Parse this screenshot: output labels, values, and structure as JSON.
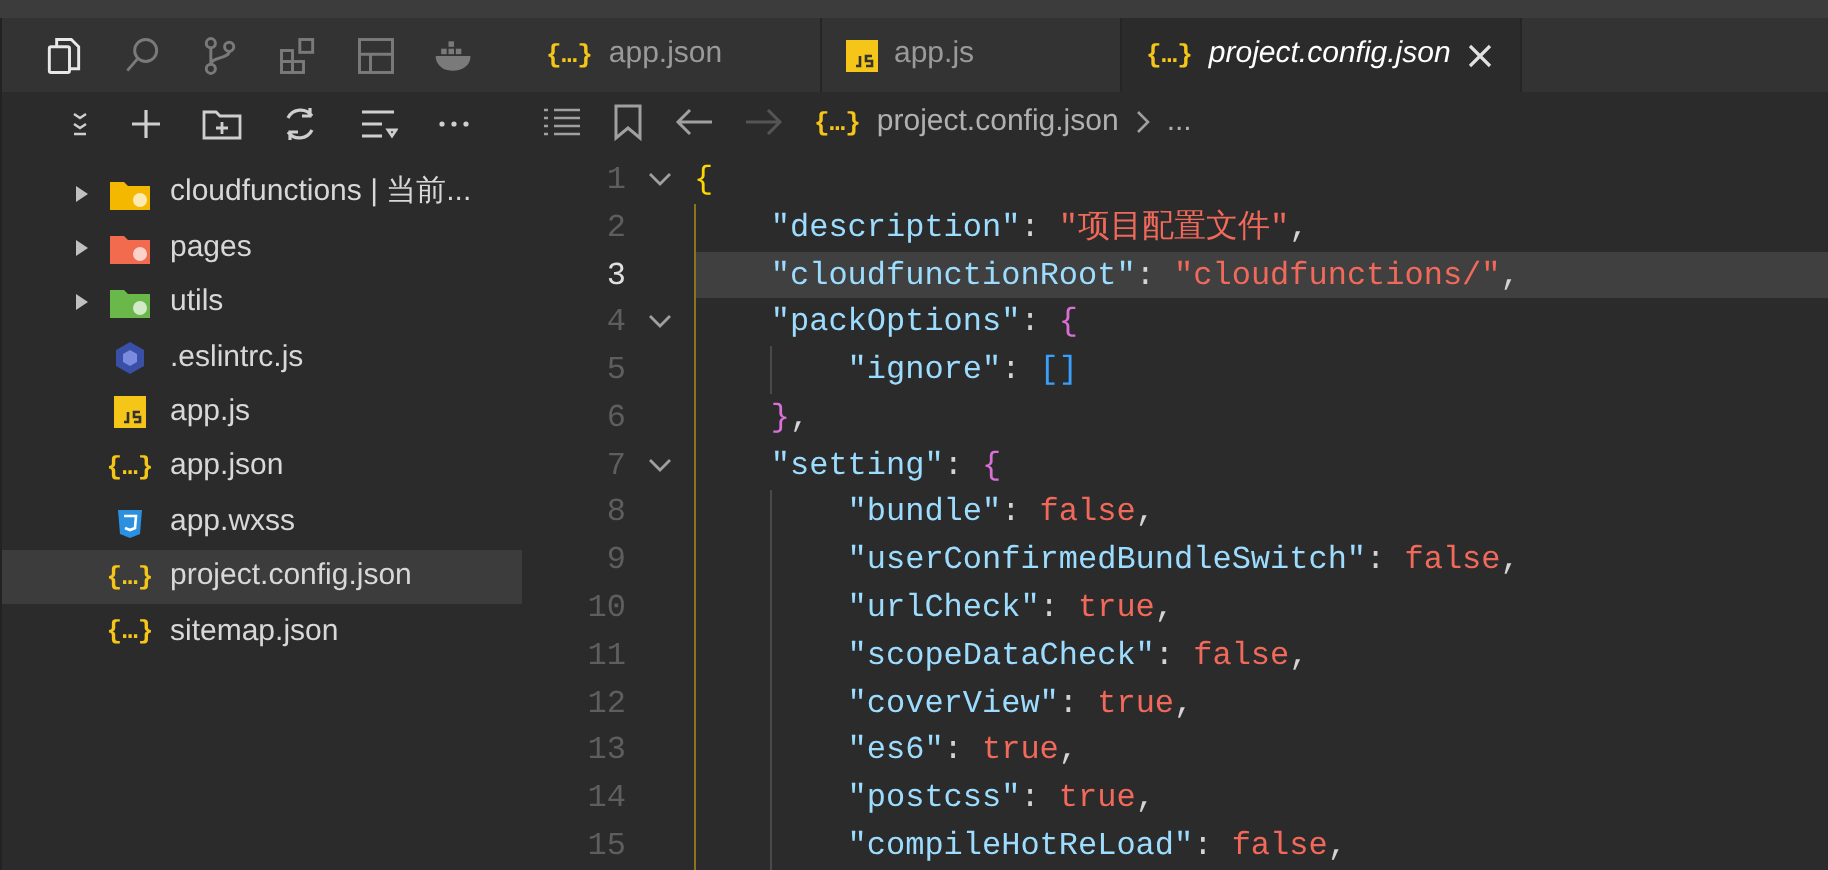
{
  "activity_bar": {
    "items": [
      {
        "selected": true
      },
      {
        "selected": false
      },
      {
        "selected": false
      },
      {
        "selected": false
      },
      {
        "selected": false
      },
      {
        "selected": false
      }
    ]
  },
  "tabs": [
    {
      "label": "app.json",
      "kind": "json",
      "icon_text": "{…}",
      "selected": false
    },
    {
      "label": "app.js",
      "kind": "js",
      "selected": false
    },
    {
      "label": "project.config.json",
      "kind": "json",
      "icon_text": "{…}",
      "selected": true
    }
  ],
  "sidebar": {
    "items": [
      {
        "label": "cloudfunctions | 当前...",
        "kind": "folder",
        "color": "#f5b800",
        "expanded": false,
        "selected": false
      },
      {
        "label": "pages",
        "kind": "folder",
        "color": "#f26b4f",
        "expanded": false,
        "selected": false
      },
      {
        "label": "utils",
        "kind": "folder",
        "color": "#6bb84a",
        "expanded": false,
        "selected": false
      },
      {
        "label": ".eslintrc.js",
        "kind": "eslint",
        "selected": false
      },
      {
        "label": "app.js",
        "kind": "js",
        "selected": false
      },
      {
        "label": "app.json",
        "kind": "json",
        "icon_text": "{…}",
        "selected": false
      },
      {
        "label": "app.wxss",
        "kind": "css",
        "selected": false
      },
      {
        "label": "project.config.json",
        "kind": "json",
        "icon_text": "{…}",
        "selected": true
      },
      {
        "label": "sitemap.json",
        "kind": "json",
        "icon_text": "{…}",
        "selected": false
      }
    ]
  },
  "breadcrumb": {
    "icon_text": "{…}",
    "file": "project.config.json",
    "rest": "..."
  },
  "editor": {
    "lines": [
      {
        "number": "1",
        "foldable": true,
        "current": false,
        "tokens": [
          {
            "text": "{",
            "kind": "brace1"
          }
        ],
        "children": [
          {
            "number": "2",
            "foldable": false,
            "current": false,
            "tokens": [
              {
                "text": "\"description\"",
                "kind": "key"
              },
              {
                "text": ": ",
                "kind": "punct"
              },
              {
                "text": "\"项目配置文件\"",
                "kind": "string"
              },
              {
                "text": ",",
                "kind": "punct"
              }
            ]
          },
          {
            "number": "3",
            "foldable": false,
            "current": true,
            "tokens": [
              {
                "text": "\"cloudfunctionRoot\"",
                "kind": "key"
              },
              {
                "text": ": ",
                "kind": "punct"
              },
              {
                "text": "\"cloudfunctions/\"",
                "kind": "string"
              },
              {
                "text": ",",
                "kind": "punct"
              }
            ]
          },
          {
            "number": "4",
            "foldable": true,
            "current": false,
            "tokens": [
              {
                "text": "\"packOptions\"",
                "kind": "key"
              },
              {
                "text": ": ",
                "kind": "punct"
              },
              {
                "text": "{",
                "kind": "brace2"
              }
            ],
            "children": [
              {
                "number": "5",
                "foldable": false,
                "current": false,
                "tokens": [
                  {
                    "text": "\"ignore\"",
                    "kind": "key"
                  },
                  {
                    "text": ": ",
                    "kind": "punct"
                  },
                  {
                    "text": "[]",
                    "kind": "brace3"
                  }
                ]
              }
            ]
          },
          {
            "number": "6",
            "foldable": false,
            "current": false,
            "tokens": [
              {
                "text": "}",
                "kind": "brace2"
              },
              {
                "text": ",",
                "kind": "punct"
              }
            ]
          },
          {
            "number": "7",
            "foldable": true,
            "current": false,
            "tokens": [
              {
                "text": "\"setting\"",
                "kind": "key"
              },
              {
                "text": ": ",
                "kind": "punct"
              },
              {
                "text": "{",
                "kind": "brace2"
              }
            ],
            "children": [
              {
                "number": "8",
                "foldable": false,
                "current": false,
                "tokens": [
                  {
                    "text": "\"bundle\"",
                    "kind": "key"
                  },
                  {
                    "text": ": ",
                    "kind": "punct"
                  },
                  {
                    "text": "false",
                    "kind": "value"
                  },
                  {
                    "text": ",",
                    "kind": "punct"
                  }
                ]
              },
              {
                "number": "9",
                "foldable": false,
                "current": false,
                "tokens": [
                  {
                    "text": "\"userConfirmedBundleSwitch\"",
                    "kind": "key"
                  },
                  {
                    "text": ": ",
                    "kind": "punct"
                  },
                  {
                    "text": "false",
                    "kind": "value"
                  },
                  {
                    "text": ",",
                    "kind": "punct"
                  }
                ]
              },
              {
                "number": "10",
                "foldable": false,
                "current": false,
                "tokens": [
                  {
                    "text": "\"urlCheck\"",
                    "kind": "key"
                  },
                  {
                    "text": ": ",
                    "kind": "punct"
                  },
                  {
                    "text": "true",
                    "kind": "value"
                  },
                  {
                    "text": ",",
                    "kind": "punct"
                  }
                ]
              },
              {
                "number": "11",
                "foldable": false,
                "current": false,
                "tokens": [
                  {
                    "text": "\"scopeDataCheck\"",
                    "kind": "key"
                  },
                  {
                    "text": ": ",
                    "kind": "punct"
                  },
                  {
                    "text": "false",
                    "kind": "value"
                  },
                  {
                    "text": ",",
                    "kind": "punct"
                  }
                ]
              },
              {
                "number": "12",
                "foldable": false,
                "current": false,
                "tokens": [
                  {
                    "text": "\"coverView\"",
                    "kind": "key"
                  },
                  {
                    "text": ": ",
                    "kind": "punct"
                  },
                  {
                    "text": "true",
                    "kind": "value"
                  },
                  {
                    "text": ",",
                    "kind": "punct"
                  }
                ]
              },
              {
                "number": "13",
                "foldable": false,
                "current": false,
                "tokens": [
                  {
                    "text": "\"es6\"",
                    "kind": "key"
                  },
                  {
                    "text": ": ",
                    "kind": "punct"
                  },
                  {
                    "text": "true",
                    "kind": "value"
                  },
                  {
                    "text": ",",
                    "kind": "punct"
                  }
                ]
              },
              {
                "number": "14",
                "foldable": false,
                "current": false,
                "tokens": [
                  {
                    "text": "\"postcss\"",
                    "kind": "key"
                  },
                  {
                    "text": ": ",
                    "kind": "punct"
                  },
                  {
                    "text": "true",
                    "kind": "value"
                  },
                  {
                    "text": ",",
                    "kind": "punct"
                  }
                ]
              },
              {
                "number": "15",
                "foldable": false,
                "current": false,
                "tokens": [
                  {
                    "text": "\"compileHotReLoad\"",
                    "kind": "key"
                  },
                  {
                    "text": ": ",
                    "kind": "punct"
                  },
                  {
                    "text": "false",
                    "kind": "value"
                  },
                  {
                    "text": ",",
                    "kind": "punct"
                  }
                ]
              }
            ]
          }
        ]
      }
    ]
  }
}
